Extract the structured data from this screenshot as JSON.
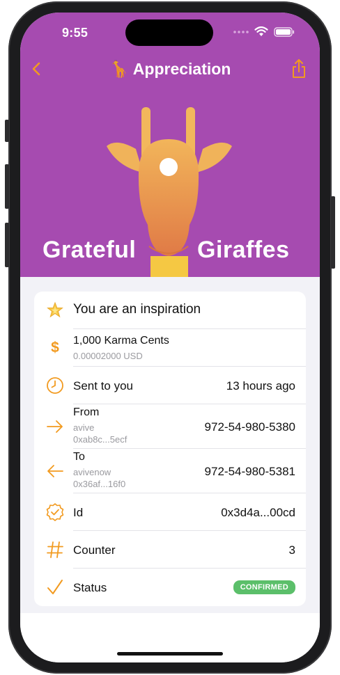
{
  "status_bar": {
    "time": "9:55"
  },
  "nav": {
    "title": "🦒 Appreciation"
  },
  "hero": {
    "brand_left": "Grateful",
    "brand_right": "Giraffes",
    "background_color": "#a64bb0"
  },
  "accent_color": "#f29a1f",
  "rows": {
    "message": {
      "icon": "sparkle-star-icon",
      "text": "You are an inspiration"
    },
    "amount": {
      "icon": "dollar-icon",
      "title": "1,000 Karma Cents",
      "subtitle": "0.00002000 USD"
    },
    "sent": {
      "icon": "clock-icon",
      "label": "Sent to you",
      "value": "13 hours ago"
    },
    "from": {
      "icon": "arrow-right-icon",
      "label": "From",
      "name": "avive",
      "address": "0xab8c...5ecf",
      "value": "972-54-980-5380"
    },
    "to": {
      "icon": "arrow-left-icon",
      "label": "To",
      "name": "avivenow",
      "address": "0x36af...16f0",
      "value": "972-54-980-5381"
    },
    "id": {
      "icon": "verified-badge-icon",
      "label": "Id",
      "value": "0x3d4a...00cd"
    },
    "counter": {
      "icon": "hash-icon",
      "label": "Counter",
      "value": "3"
    },
    "status": {
      "icon": "checkmark-icon",
      "label": "Status",
      "value": "CONFIRMED",
      "badge_color": "#5bbf6a"
    }
  }
}
